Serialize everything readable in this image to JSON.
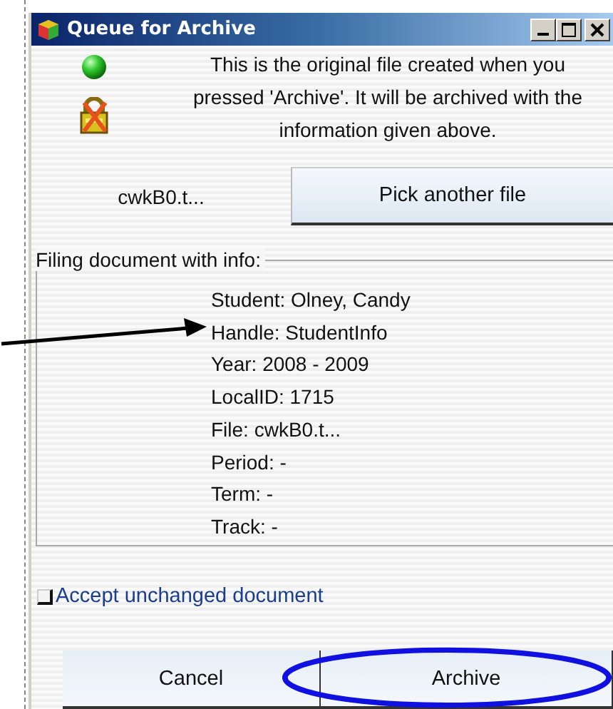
{
  "window": {
    "title": "Queue for Archive"
  },
  "message": "This is the original file created when you pressed 'Archive'. It will be archived with the information given above.",
  "file_name": "cwkB0.t...",
  "pick_button": "Pick another file",
  "info_group": {
    "legend": "Filing document with info:",
    "lines": [
      "Student: Olney, Candy",
      "Handle: StudentInfo",
      "Year: 2008 - 2009",
      "LocalID: 1715",
      "File: cwkB0.t...",
      "Period: -",
      "Term: -",
      "Track: -"
    ]
  },
  "accept_checkbox": {
    "label": "Accept unchanged document",
    "checked": false
  },
  "buttons": [
    {
      "label": "Cancel",
      "highlighted": false
    },
    {
      "label": "Archive",
      "highlighted": true
    }
  ]
}
